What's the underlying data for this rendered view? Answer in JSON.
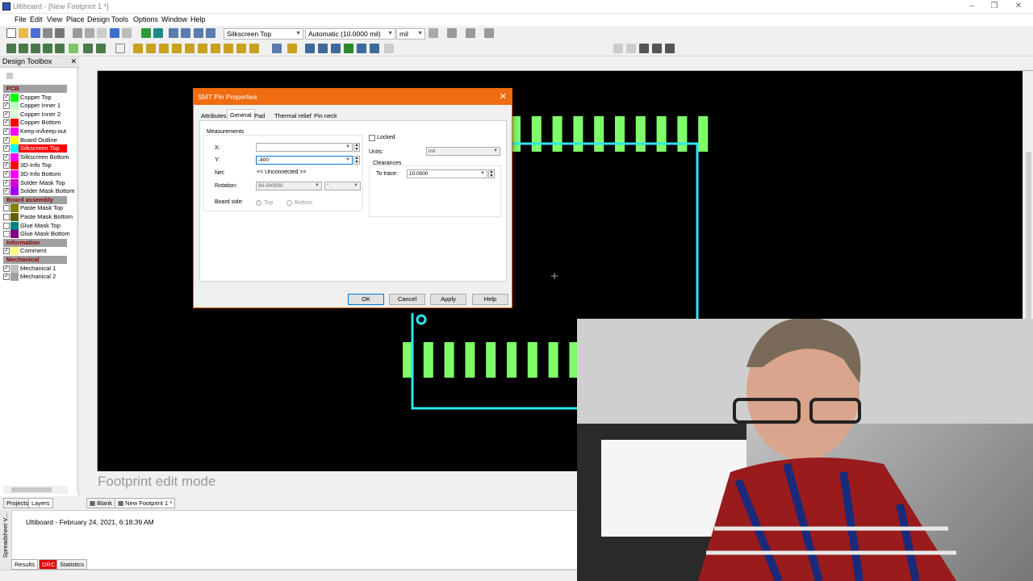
{
  "window": {
    "title": "Ultiboard - [New Footprint 1 *]"
  },
  "menu": [
    "File",
    "Edit",
    "View",
    "Place",
    "Design",
    "Tools",
    "Options",
    "Window",
    "Help"
  ],
  "toolbar": {
    "layer_select": "Silkscreen Top",
    "grid_select": "Automatic (10.0000 mil)",
    "units_select": "mil"
  },
  "toolbox": {
    "title": "Design Toolbox",
    "groups": [
      {
        "name": "PCB",
        "layers": [
          {
            "label": "Copper Top",
            "color": "#00ff00",
            "checked": true
          },
          {
            "label": "Copper Inner 1",
            "color": "#c0ffc0",
            "checked": true
          },
          {
            "label": "Copper Inner 2",
            "color": "#d8ffd8",
            "checked": true
          },
          {
            "label": "Copper Bottom",
            "color": "#ff0000",
            "checked": true
          },
          {
            "label": "Keep-in/keep-out",
            "color": "#ff00ff",
            "checked": true
          },
          {
            "label": "Board Outline",
            "color": "#ffff00",
            "checked": true
          },
          {
            "label": "Silkscreen Top",
            "color": "#00ffff",
            "checked": true,
            "selected": true
          },
          {
            "label": "Silkscreen Bottom",
            "color": "#ff00ff",
            "checked": true
          },
          {
            "label": "3D-Info Top",
            "color": "#ff0000",
            "checked": true
          },
          {
            "label": "3D-Info Bottom",
            "color": "#ff00ff",
            "checked": true
          },
          {
            "label": "Solder Mask Top",
            "color": "#d000d0",
            "checked": true
          },
          {
            "label": "Solder Mask Bottom",
            "color": "#a000ff",
            "checked": true
          }
        ]
      },
      {
        "name": "Board assembly",
        "layers": [
          {
            "label": "Paste Mask Top",
            "color": "#808000",
            "checked": false
          },
          {
            "label": "Paste Mask Bottom",
            "color": "#606000",
            "checked": false
          },
          {
            "label": "Glue Mask Top",
            "color": "#008080",
            "checked": false
          },
          {
            "label": "Glue Mask Bottom",
            "color": "#800080",
            "checked": false
          }
        ]
      },
      {
        "name": "Information",
        "layers": [
          {
            "label": "Comment",
            "color": "#ffff80",
            "checked": true
          }
        ]
      },
      {
        "name": "Mechanical",
        "layers": [
          {
            "label": "Mechanical 1",
            "color": "#c0c0c0",
            "checked": true
          },
          {
            "label": "Mechanical 2",
            "color": "#a0a0a0",
            "checked": true
          }
        ]
      }
    ],
    "tabs": [
      "Projects",
      "Layers"
    ]
  },
  "canvas": {
    "mode_text": "Footprint edit mode",
    "pad_color": "#7fff6a",
    "outline_color": "#2ee6f0",
    "background": "#000000"
  },
  "doc_tabs": [
    "Blank",
    "New Footprint 1 *"
  ],
  "output": {
    "line": "Ultiboard  -  February 24, 2021, 6:18:39 AM",
    "tabs": [
      "Results",
      "DRC",
      "Statistics"
    ],
    "side_label": "Spreadsheet V..."
  },
  "dialog": {
    "title": "SMT Pin Properties",
    "tabs": [
      "Attributes",
      "General",
      "Pad",
      "Thermal relief",
      "Pin neck"
    ],
    "active_tab": "General",
    "measurements_label": "Measurements",
    "x_label": "X:",
    "x_value": "",
    "y_label": "Y:",
    "y_value": "-400",
    "net_label": "Net:",
    "net_value": "<< Unconnected >>",
    "rotation_label": "Rotation:",
    "rotation_value": "90.000000",
    "rotation_unit": "°",
    "board_side_label": "Board side:",
    "side_top": "Top",
    "side_bottom": "Bottom",
    "locked_label": "Locked",
    "units_label": "Units:",
    "units_value": "mil",
    "clearances_label": "Clearances",
    "to_trace_label": "To trace:",
    "to_trace_value": "10.0000",
    "buttons": {
      "ok": "OK",
      "cancel": "Cancel",
      "apply": "Apply",
      "help": "Help"
    }
  }
}
